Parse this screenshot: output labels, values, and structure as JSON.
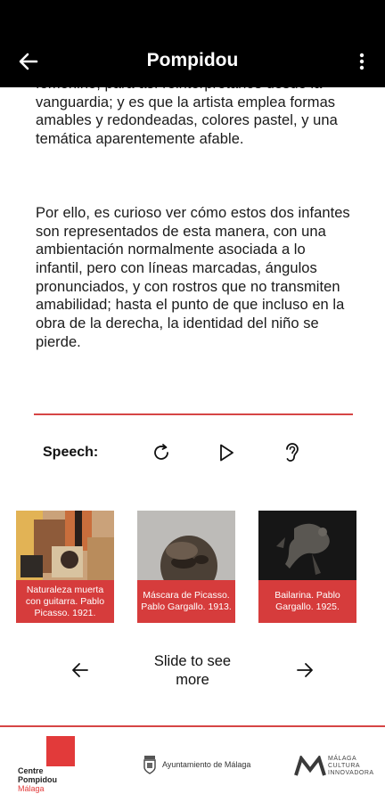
{
  "app_bar": {
    "title": "Pompidou",
    "back_icon": "arrow-left-icon",
    "menu_icon": "more-vertical-icon"
  },
  "article": {
    "paragraph_1": "femenino, para así reinterpretarlos desde la vanguardia; y es que la artista emplea formas amables y redondeadas, colores pastel, y una temática aparentemente afable.",
    "paragraph_2": "Por ello, es curioso ver cómo estos dos infantes son representados de esta manera, con una ambientación normalmente asociada a lo infantil, pero con líneas marcadas, ángulos pronunciados, y con rostros que no transmiten amabilidad; hasta el punto de que incluso en la obra de la derecha, la identidad del niño se pierde."
  },
  "speech": {
    "label": "Speech:",
    "buttons": [
      "refresh-icon",
      "play-icon",
      "ear-icon"
    ]
  },
  "artworks": [
    {
      "caption": "Naturaleza muerta con guitarra. Pablo Picasso. 1921."
    },
    {
      "caption": "Máscara de Picasso. Pablo Gargallo. 1913."
    },
    {
      "caption": "Bailarina. Pablo Gargallo. 1925."
    }
  ],
  "slider": {
    "text": "Slide to see more"
  },
  "footer": {
    "centre_pompidou": {
      "line1": "Centre",
      "line2": "Pompidou",
      "line3": "Málaga"
    },
    "ayuntamiento": "Ayuntamiento de Málaga",
    "cultura": {
      "line1": "MÁLAGA",
      "line2": "CULTURA",
      "line3": "INNOVADORA"
    }
  },
  "colors": {
    "accent_red": "#d63c3c",
    "app_bar": "#000000"
  }
}
